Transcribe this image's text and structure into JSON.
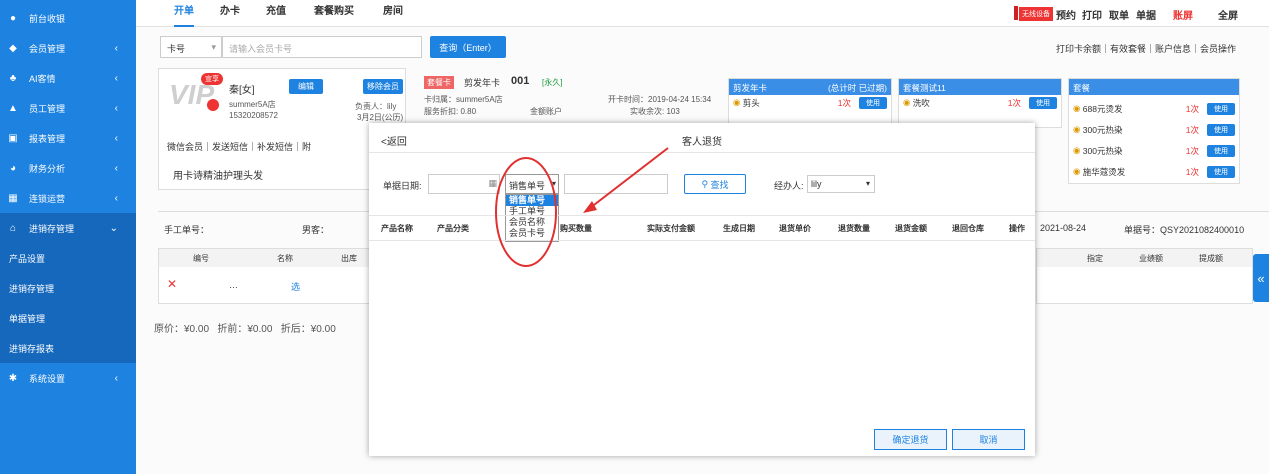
{
  "sidebar": {
    "items": [
      {
        "label": "前台收银",
        "icon": "dollar-icon"
      },
      {
        "label": "会员管理",
        "icon": "diamond-icon"
      },
      {
        "label": "AI客情",
        "icon": "users-icon"
      },
      {
        "label": "员工管理",
        "icon": "user-icon"
      },
      {
        "label": "报表管理",
        "icon": "monitor-icon"
      },
      {
        "label": "财务分析",
        "icon": "pie-icon"
      },
      {
        "label": "连锁运营",
        "icon": "building-icon"
      },
      {
        "label": "进销存管理",
        "icon": "home-icon"
      },
      {
        "label": "系统设置",
        "icon": "gear-icon"
      }
    ],
    "subitems": [
      "产品设置",
      "进销存管理",
      "单据管理",
      "进销存报表"
    ]
  },
  "topbar": {
    "tabs": [
      "开单",
      "办卡",
      "充值",
      "套餐购买",
      "房间"
    ],
    "badge": "无线设备",
    "actions": [
      "预约",
      "打印",
      "取单",
      "单据",
      "账屏",
      "全屏"
    ]
  },
  "search": {
    "type": "卡号",
    "placeholder": "请输入会员卡号",
    "button": "查询（Enter）",
    "links": "打印卡余额｜有效套餐｜账户信息｜会员操作"
  },
  "member": {
    "badge": "宣享",
    "name": "秦[女]",
    "edit": "编辑",
    "remove": "移除会员",
    "store": "summer5A店",
    "phone": "15320208572",
    "manager": "负责人：lily",
    "date": "3月2日(公历)",
    "links": "微信会员｜发送短信｜补发短信｜附",
    "note": "用卡诗精油护理头发"
  },
  "card": {
    "tag": "套餐卡",
    "name": "剪发年卡",
    "num": "001",
    "status": "[永久]",
    "store": "卡归属：summer5A店",
    "discount": "服务折扣: 0.80",
    "shared": "金额账户",
    "opened": "开卡时间：2019-04-24 15:34",
    "balance": "实收余次: 103"
  },
  "packages": [
    {
      "title": "剪发年卡",
      "sub": "(总计时 已过期)",
      "rows": [
        {
          "name": "剪头",
          "count": "1次",
          "btn": "使用"
        }
      ]
    },
    {
      "title": "套餐测试11",
      "sub": "",
      "rows": [
        {
          "name": "洗吹",
          "count": "1次",
          "btn": "使用"
        }
      ]
    },
    {
      "title": "套餐",
      "sub": "",
      "rows": [
        {
          "name": "688元烫发",
          "count": "1次",
          "btn": "使用"
        },
        {
          "name": "300元热染",
          "count": "1次",
          "btn": "使用"
        },
        {
          "name": "300元热染",
          "count": "1次",
          "btn": "使用"
        },
        {
          "name": "施华蔻烫发",
          "count": "1次",
          "btn": "使用"
        }
      ]
    }
  ],
  "order": {
    "manual": "手工单号：",
    "gender": "男客：",
    "date": "2021-08-24",
    "no": "单据号：QSY2021082400010",
    "cols": [
      "编号",
      "名称",
      "出库"
    ],
    "cols_right": [
      "指定",
      "业绩额",
      "提成额"
    ],
    "select": "选",
    "original": "原价：¥0.00",
    "discount": "折前：¥0.00",
    "after": "折后：¥0.00"
  },
  "modal": {
    "back": "<返回",
    "title": "客人退货",
    "date_label": "单据日期:",
    "select_value": "销售单号",
    "options": [
      "销售单号",
      "手工单号",
      "会员名称",
      "会员卡号"
    ],
    "find": "查找",
    "handler_label": "经办人:",
    "handler": "lily",
    "cols": [
      "产品名称",
      "产品分类",
      "单价",
      "购买数量",
      "实际支付金额",
      "生成日期",
      "退货单价",
      "退货数量",
      "退货金额",
      "退回仓库",
      "操作"
    ],
    "confirm": "确定退货",
    "cancel": "取消"
  },
  "colors": {
    "sidebar": "#1e82e0",
    "accent": "#1e82e0",
    "annotation": "#e03030"
  }
}
